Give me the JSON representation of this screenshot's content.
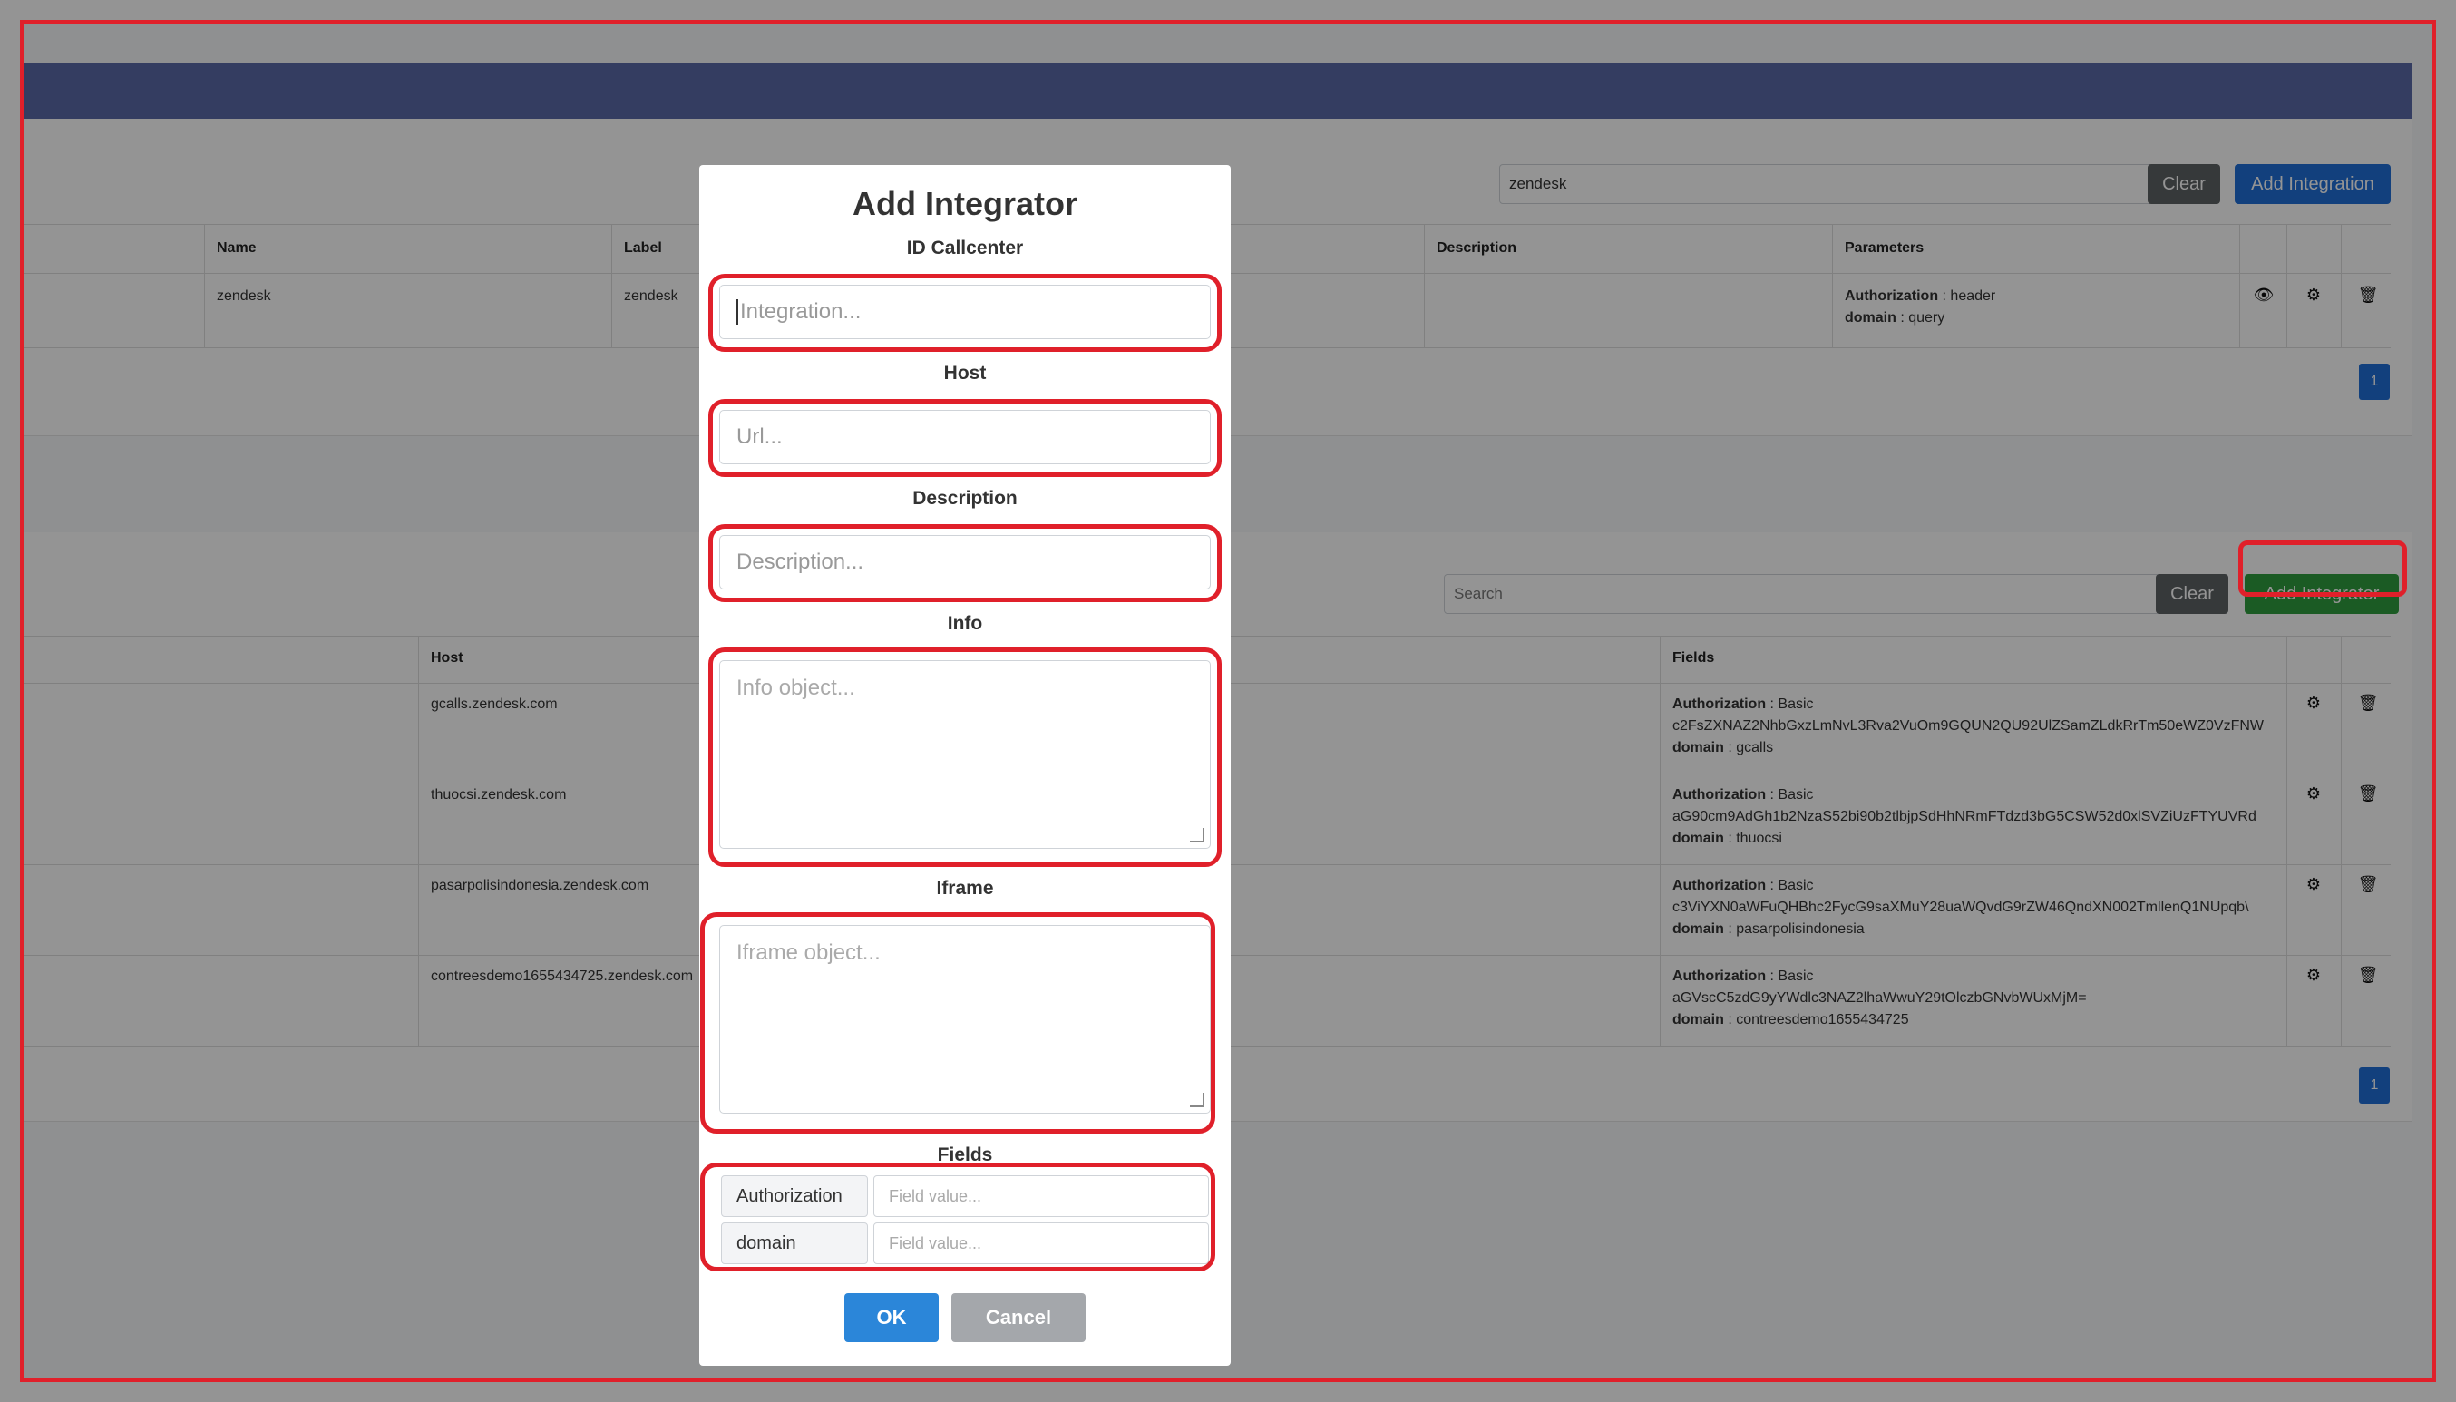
{
  "integrations": {
    "search_value": "zendesk",
    "clear_label": "Clear",
    "add_label": "Add Integration",
    "columns": [
      "Name",
      "Label",
      "Description",
      "Parameters"
    ],
    "row": {
      "name": "zendesk",
      "label": "zendesk",
      "description": "",
      "param1_key": "Authorization",
      "param1_val": " : header",
      "param2_key": "domain",
      "param2_val": " : query"
    },
    "page": "1"
  },
  "integrators": {
    "search_placeholder": "Search",
    "clear_label": "Clear",
    "add_label": "Add Integrator",
    "columns": [
      "Host",
      "Fields"
    ],
    "rows": [
      {
        "host": "gcalls.zendesk.com",
        "auth_key": "Authorization",
        "auth_val": " : Basic",
        "token": "c2FsZXNAZ2NhbGxzLmNvL3Rva2VuOm9GQUN2QU92UlZSamZLdkRrTm50eWZ0VzFNW",
        "domain_key": "domain",
        "domain_val": " : gcalls"
      },
      {
        "host": "thuocsi.zendesk.com",
        "auth_key": "Authorization",
        "auth_val": " : Basic",
        "token": "aG90cm9AdGh1b2NzaS52bi90b2tlbjpSdHhNRmFTdzd3bG5CSW52d0xlSVZiUzFTYUVRd",
        "domain_key": "domain",
        "domain_val": " : thuocsi"
      },
      {
        "host": "pasarpolisindonesia.zendesk.com",
        "auth_key": "Authorization",
        "auth_val": " : Basic",
        "token": "c3ViYXN0aWFuQHBhc2FycG9saXMuY28uaWQvdG9rZW46QndXN002TmllenQ1NUpqb\\",
        "domain_key": "domain",
        "domain_val": " : pasarpolisindonesia"
      },
      {
        "host": "contreesdemo1655434725.zendesk.com",
        "auth_key": "Authorization",
        "auth_val": " : Basic",
        "token": "aGVscC5zdG9yYWdlc3NAZ2lhaWwuY29tOlczbGNvbWUxMjM=",
        "domain_key": "domain",
        "domain_val": " : contreesdemo1655434725"
      }
    ],
    "page": "1"
  },
  "modal": {
    "title": "Add Integrator",
    "id_label": "ID Callcenter",
    "id_placeholder": "Integration...",
    "host_label": "Host",
    "host_placeholder": "Url...",
    "desc_label": "Description",
    "desc_placeholder": "Description...",
    "info_label": "Info",
    "info_placeholder": "Info object...",
    "iframe_label": "Iframe",
    "iframe_placeholder": "Iframe object...",
    "fields_label": "Fields",
    "fields": [
      {
        "key": "Authorization",
        "placeholder": "Field value..."
      },
      {
        "key": "domain",
        "placeholder": "Field value..."
      }
    ],
    "ok_label": "OK",
    "cancel_label": "Cancel"
  },
  "colors": {
    "highlight": "#e0202a",
    "primary": "#1f6fd8",
    "success": "#2f9e3f",
    "header": "#5a6aa8"
  }
}
